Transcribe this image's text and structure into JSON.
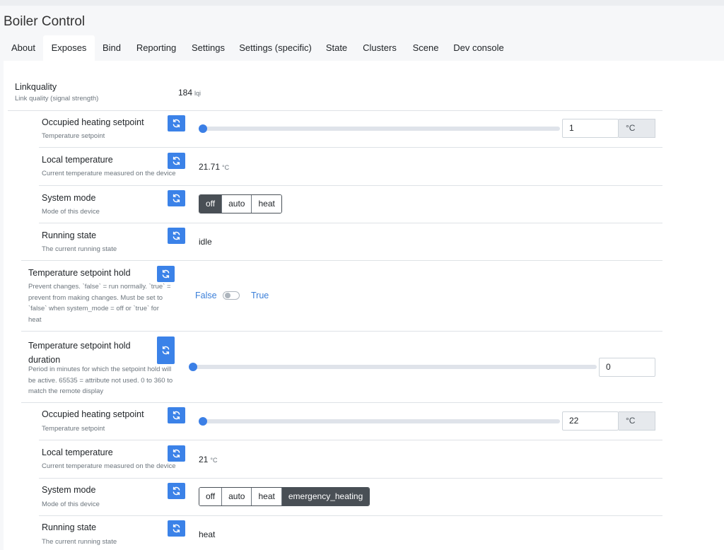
{
  "app": {
    "title": "Boiler Control"
  },
  "tabs": [
    "About",
    "Exposes",
    "Bind",
    "Reporting",
    "Settings",
    "Settings (specific)",
    "State",
    "Clusters",
    "Scene",
    "Dev console"
  ],
  "active_tab": "Exposes",
  "linkquality": {
    "label": "Linkquality",
    "desc": "Link quality (signal strength)",
    "value": "184",
    "unit": "lqi"
  },
  "group1": {
    "occupied": {
      "label": "Occupied heating setpoint",
      "desc": "Temperature setpoint",
      "value": "1",
      "unit": "°C",
      "slider_fraction": 0.0
    },
    "local": {
      "label": "Local temperature",
      "desc": "Current temperature measured on the device",
      "value": "21.71",
      "unit": "°C"
    },
    "mode": {
      "label": "System mode",
      "desc": "Mode of this device",
      "options": [
        "off",
        "auto",
        "heat"
      ],
      "selected": "off"
    },
    "running": {
      "label": "Running state",
      "desc": "The current running state",
      "value": "idle"
    }
  },
  "hold": {
    "label": "Temperature setpoint hold",
    "desc_lines": [
      "Prevent changes. `false` = run normally. `true` =",
      "prevent from making changes. Must be set to",
      "`false` when system_mode = off or `true` for",
      "heat"
    ],
    "false_label": "False",
    "true_label": "True",
    "value": false
  },
  "hold_duration": {
    "label_lines": [
      "Temperature setpoint hold",
      "duration"
    ],
    "desc_lines": [
      "Period in minutes for which the setpoint hold will",
      "be active. 65535 = attribute not used. 0 to 360 to",
      "match the remote display"
    ],
    "value": "0",
    "slider_fraction": 0.0
  },
  "group2": {
    "occupied": {
      "label": "Occupied heating setpoint",
      "desc": "Temperature setpoint",
      "value": "22",
      "unit": "°C",
      "slider_fraction": 0.0
    },
    "local": {
      "label": "Local temperature",
      "desc": "Current temperature measured on the device",
      "value": "21",
      "unit": "°C"
    },
    "mode": {
      "label": "System mode",
      "desc": "Mode of this device",
      "options": [
        "off",
        "auto",
        "heat",
        "emergency_heating"
      ],
      "selected": "emergency_heating"
    },
    "running": {
      "label": "Running state",
      "desc": "The current running state",
      "value": "heat"
    }
  },
  "colors": {
    "accent": "#3b82e8",
    "link": "#3b7fd9",
    "active_segment": "#494f55"
  },
  "icons": {
    "refresh": "refresh-icon"
  }
}
